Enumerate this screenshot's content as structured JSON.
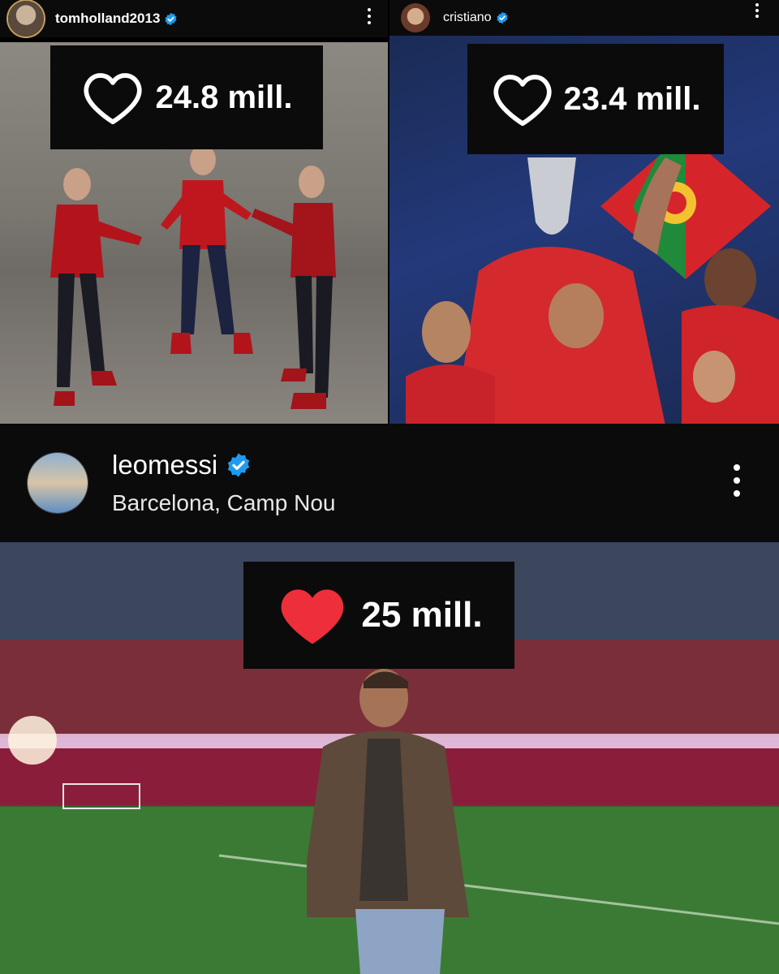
{
  "posts": [
    {
      "username": "tomholland2013",
      "verified": true,
      "likes": "24.8 mill.",
      "liked": false,
      "avatar_icon": "profile-photo",
      "menu_icon": "more-vertical-icon"
    },
    {
      "username": "cristiano",
      "verified": true,
      "likes": "23.4 mill.",
      "liked": false,
      "avatar_icon": "profile-photo",
      "menu_icon": "more-vertical-icon"
    },
    {
      "username": "leomessi",
      "verified": true,
      "location": "Barcelona, Camp Nou",
      "likes": "25 mill.",
      "liked": true,
      "avatar_icon": "profile-photo",
      "menu_icon": "more-vertical-icon"
    }
  ],
  "colors": {
    "background": "#0b0b0b",
    "verified_badge": "#1d9bf0",
    "heart_filled": "#ed2f3b",
    "heart_outline": "#ffffff"
  }
}
